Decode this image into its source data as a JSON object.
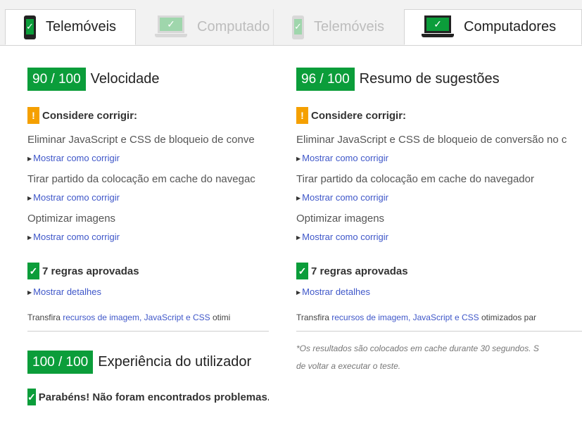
{
  "tabs": [
    {
      "label": "Telemóveis",
      "device": "phone",
      "active": true
    },
    {
      "label": "Computado",
      "device": "laptop",
      "active": false
    },
    {
      "label": "Telemóveis",
      "device": "phone",
      "active": false
    },
    {
      "label": "Computadores",
      "device": "laptop",
      "active": true
    }
  ],
  "left": {
    "speed": {
      "score": "90 / 100",
      "title": "Velocidade"
    },
    "consider_label": "Considere corrigir:",
    "rules": [
      "Eliminar JavaScript e CSS de bloqueio de conve",
      "Tirar partido da colocação em cache do navegac",
      "Optimizar imagens"
    ],
    "show_fix": "Mostrar como corrigir",
    "passed_label": "7 regras aprovadas",
    "show_details": "Mostrar detalhes",
    "note_prefix": "Transfira ",
    "note_link": "recursos de imagem, JavaScript e CSS",
    "note_suffix": " otimi",
    "ux": {
      "score": "100 / 100",
      "title": "Experiência do utilizador"
    },
    "congrats": "Parabéns! Não foram encontrados problemas."
  },
  "right": {
    "summary": {
      "score": "96 / 100",
      "title": "Resumo de sugestões"
    },
    "consider_label": "Considere corrigir:",
    "rules": [
      "Eliminar JavaScript e CSS de bloqueio de conversão no c",
      "Tirar partido da colocação em cache do navegador",
      "Optimizar imagens"
    ],
    "show_fix": "Mostrar como corrigir",
    "passed_label": "7 regras aprovadas",
    "show_details": "Mostrar detalhes",
    "note_prefix": "Transfira ",
    "note_link": "recursos de imagem, JavaScript e CSS",
    "note_suffix": " otimizados par",
    "footnote_line1": "*Os resultados são colocados em cache durante 30 segundos. S",
    "footnote_line2": "de voltar a executar o teste."
  },
  "icons": {
    "warn_glyph": "!",
    "check_glyph": "✓"
  },
  "colors": {
    "score_green": "#0b9d3a",
    "warn_orange": "#f5a000",
    "link_blue": "#3f57c9"
  }
}
